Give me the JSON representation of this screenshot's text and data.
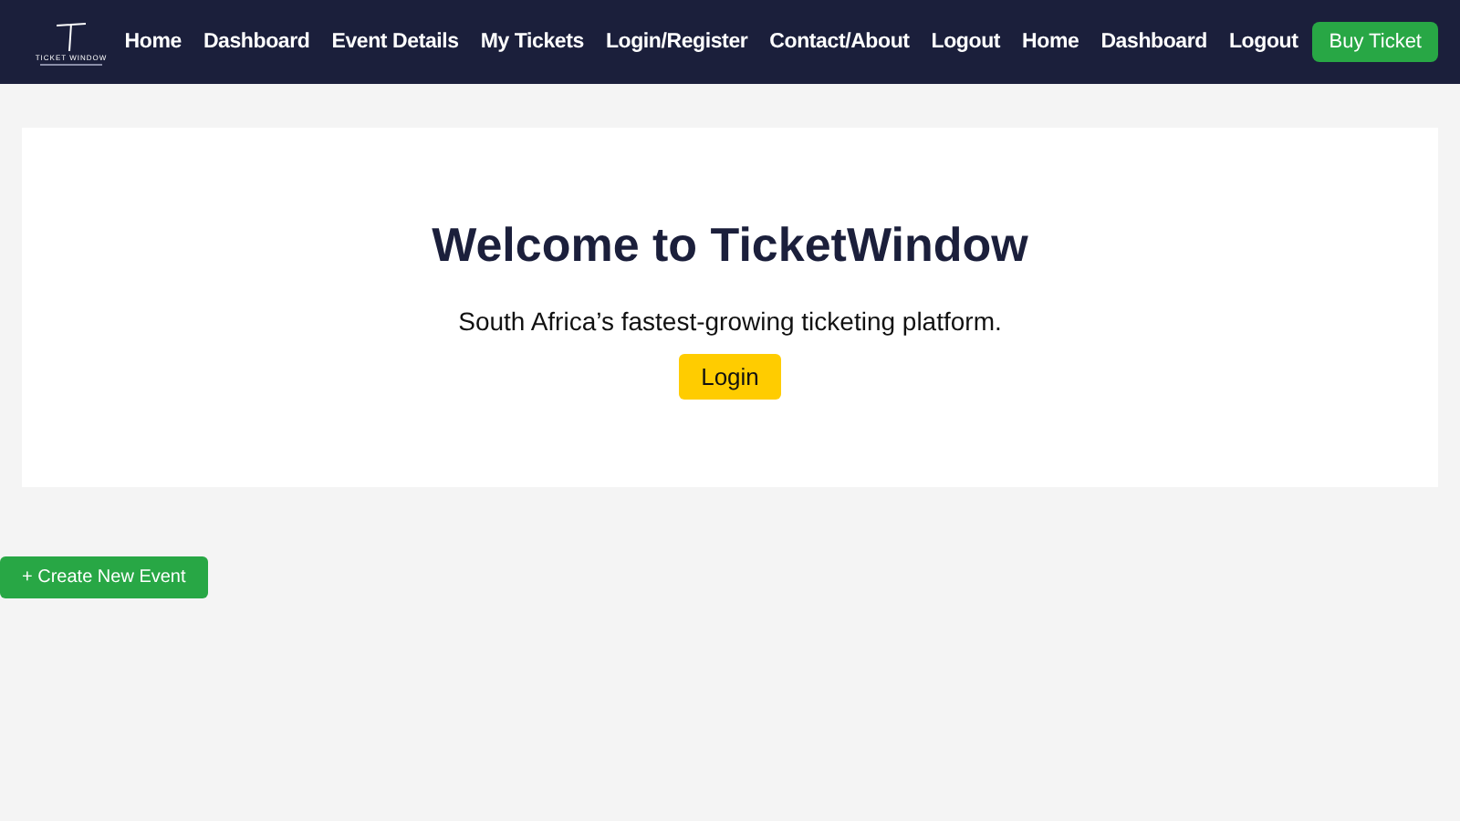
{
  "header": {
    "logo_text": "TICKET WINDOW",
    "nav": [
      "Home",
      "Dashboard",
      "Event Details",
      "My Tickets",
      "Login/Register",
      "Contact/About",
      "Logout",
      "Home",
      "Dashboard",
      "Logout"
    ],
    "action_button": "Buy Ticket"
  },
  "hero": {
    "title": "Welcome to TicketWindow",
    "subtitle": "South Africa’s fastest-growing ticketing platform.",
    "button": "Login"
  },
  "create_button": "+ Create New Event"
}
